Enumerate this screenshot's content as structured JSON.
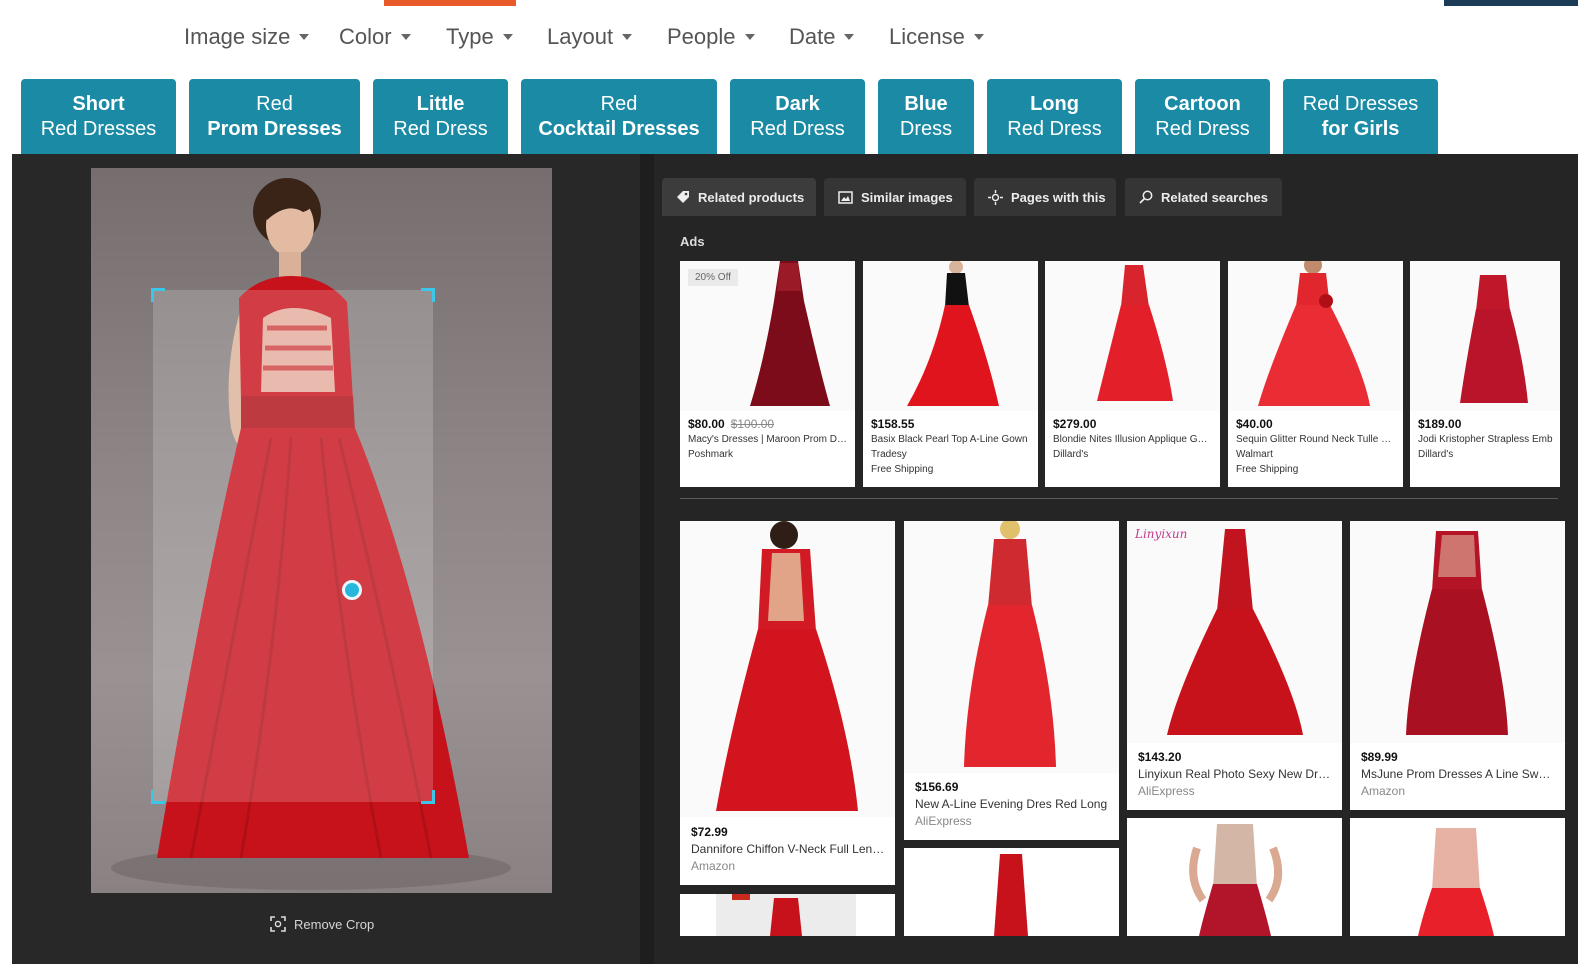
{
  "filters": [
    {
      "label": "Image size"
    },
    {
      "label": "Color"
    },
    {
      "label": "Type"
    },
    {
      "label": "Layout"
    },
    {
      "label": "People"
    },
    {
      "label": "Date"
    },
    {
      "label": "License"
    }
  ],
  "chips": [
    {
      "line1": "Short",
      "line2": "Red Dresses"
    },
    {
      "line1": "Red",
      "line2": "Prom Dresses"
    },
    {
      "line1": "Little",
      "line2": "Red Dress"
    },
    {
      "line1": "Red",
      "line2": "Cocktail Dresses"
    },
    {
      "line1": "Dark",
      "line2": "Red Dress"
    },
    {
      "line1": "Blue",
      "line2": "Dress"
    },
    {
      "line1": "Long",
      "line2": "Red Dress"
    },
    {
      "line1": "Cartoon",
      "line2": "Red Dress"
    },
    {
      "line1": "Red Dresses",
      "line2": "for Girls"
    }
  ],
  "viewer": {
    "remove_crop_label": "Remove Crop"
  },
  "tabs": [
    {
      "label": "Related products",
      "icon": "tag-icon",
      "active": true
    },
    {
      "label": "Similar images",
      "icon": "image-icon",
      "active": false
    },
    {
      "label": "Pages with this",
      "icon": "pages-icon",
      "active": false
    },
    {
      "label": "Related searches",
      "icon": "search-icon",
      "active": false
    }
  ],
  "ads_label": "Ads",
  "ads": [
    {
      "badge": "20% Off",
      "price": "$80.00",
      "old_price": "$100.00",
      "title": "Macy's Dresses | Maroon Prom Dress",
      "source": "Poshmark",
      "shipping": ""
    },
    {
      "badge": "",
      "price": "$158.55",
      "old_price": "",
      "title": "Basix Black Pearl Top A-Line Gown",
      "source": "Tradesy",
      "shipping": "Free Shipping"
    },
    {
      "badge": "",
      "price": "$279.00",
      "old_price": "",
      "title": "Blondie Nites Illusion Applique Gown",
      "source": "Dillard's",
      "shipping": ""
    },
    {
      "badge": "",
      "price": "$40.00",
      "old_price": "",
      "title": "Sequin Glitter Round Neck Tulle Dress",
      "source": "Walmart",
      "shipping": "Free Shipping"
    },
    {
      "badge": "",
      "price": "$189.00",
      "old_price": "",
      "title": "Jodi Kristopher Strapless Emb",
      "source": "Dillard's",
      "shipping": ""
    }
  ],
  "products": [
    {
      "price": "$72.99",
      "title": "Dannifore Chiffon V-Neck Full Length",
      "source": "Amazon"
    },
    {
      "price": "$156.69",
      "title": "New A-Line Evening Dres Red Long",
      "source": "AliExpress"
    },
    {
      "price": "$143.20",
      "title": "Linyixun Real Photo Sexy New Dress",
      "source": "AliExpress",
      "watermark": "Linyixun"
    },
    {
      "price": "$89.99",
      "title": "MsJune Prom Dresses A Line Sweetheart",
      "source": "Amazon"
    }
  ],
  "colors": {
    "chip_bg": "#1b8aa5",
    "viewer_bg": "#252525",
    "accent_cyan": "#27b6dc",
    "dress_red": "#c8121b"
  }
}
